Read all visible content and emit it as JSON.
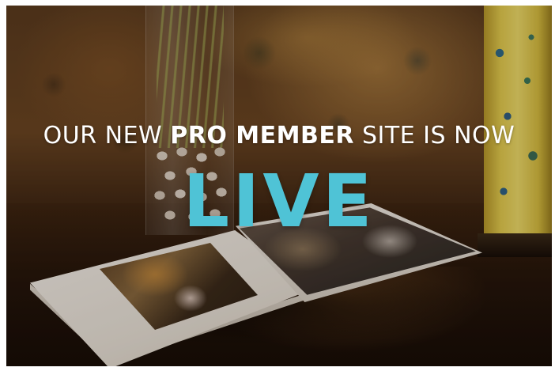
{
  "banner": {
    "line_part1": "OUR NEW ",
    "line_bold": "PRO MEMBER",
    "line_part2": " SITE IS NOW",
    "highlight": "LIVE"
  },
  "colors": {
    "highlight": "#4fc3d6",
    "text": "#ffffff"
  }
}
